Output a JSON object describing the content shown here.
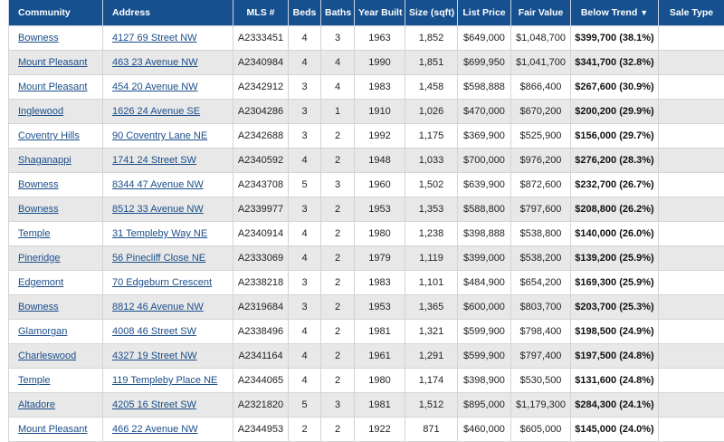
{
  "columns": {
    "community": "Community",
    "address": "Address",
    "mls": "MLS #",
    "beds": "Beds",
    "baths": "Baths",
    "year_built": "Year Built",
    "size": "Size (sqft)",
    "list_price": "List Price",
    "fair_value": "Fair Value",
    "below_trend": "Below Trend",
    "sale_type": "Sale Type"
  },
  "sort_indicator": "▼",
  "rows": [
    {
      "community": "Bowness",
      "address": "4127 69 Street NW",
      "mls": "A2333451",
      "beds": "4",
      "baths": "3",
      "year": "1963",
      "size": "1,852",
      "price": "$649,000",
      "fair": "$1,048,700",
      "trend": "$399,700 (38.1%)",
      "sale_type": ""
    },
    {
      "community": "Mount Pleasant",
      "address": "463 23 Avenue NW",
      "mls": "A2340984",
      "beds": "4",
      "baths": "4",
      "year": "1990",
      "size": "1,851",
      "price": "$699,950",
      "fair": "$1,041,700",
      "trend": "$341,700 (32.8%)",
      "sale_type": ""
    },
    {
      "community": "Mount Pleasant",
      "address": "454 20 Avenue NW",
      "mls": "A2342912",
      "beds": "3",
      "baths": "4",
      "year": "1983",
      "size": "1,458",
      "price": "$598,888",
      "fair": "$866,400",
      "trend": "$267,600 (30.9%)",
      "sale_type": ""
    },
    {
      "community": "Inglewood",
      "address": "1626 24 Avenue SE",
      "mls": "A2304286",
      "beds": "3",
      "baths": "1",
      "year": "1910",
      "size": "1,026",
      "price": "$470,000",
      "fair": "$670,200",
      "trend": "$200,200 (29.9%)",
      "sale_type": ""
    },
    {
      "community": "Coventry Hills",
      "address": "90 Coventry Lane NE",
      "mls": "A2342688",
      "beds": "3",
      "baths": "2",
      "year": "1992",
      "size": "1,175",
      "price": "$369,900",
      "fair": "$525,900",
      "trend": "$156,000 (29.7%)",
      "sale_type": ""
    },
    {
      "community": "Shaganappi",
      "address": "1741 24 Street SW",
      "mls": "A2340592",
      "beds": "4",
      "baths": "2",
      "year": "1948",
      "size": "1,033",
      "price": "$700,000",
      "fair": "$976,200",
      "trend": "$276,200 (28.3%)",
      "sale_type": ""
    },
    {
      "community": "Bowness",
      "address": "8344 47 Avenue NW",
      "mls": "A2343708",
      "beds": "5",
      "baths": "3",
      "year": "1960",
      "size": "1,502",
      "price": "$639,900",
      "fair": "$872,600",
      "trend": "$232,700 (26.7%)",
      "sale_type": ""
    },
    {
      "community": "Bowness",
      "address": "8512 33 Avenue NW",
      "mls": "A2339977",
      "beds": "3",
      "baths": "2",
      "year": "1953",
      "size": "1,353",
      "price": "$588,800",
      "fair": "$797,600",
      "trend": "$208,800 (26.2%)",
      "sale_type": ""
    },
    {
      "community": "Temple",
      "address": "31 Templeby Way NE",
      "mls": "A2340914",
      "beds": "4",
      "baths": "2",
      "year": "1980",
      "size": "1,238",
      "price": "$398,888",
      "fair": "$538,800",
      "trend": "$140,000 (26.0%)",
      "sale_type": ""
    },
    {
      "community": "Pineridge",
      "address": "56 Pinecliff Close NE",
      "mls": "A2333069",
      "beds": "4",
      "baths": "2",
      "year": "1979",
      "size": "1,119",
      "price": "$399,000",
      "fair": "$538,200",
      "trend": "$139,200 (25.9%)",
      "sale_type": ""
    },
    {
      "community": "Edgemont",
      "address": "70 Edgeburn Crescent",
      "mls": "A2338218",
      "beds": "3",
      "baths": "2",
      "year": "1983",
      "size": "1,101",
      "price": "$484,900",
      "fair": "$654,200",
      "trend": "$169,300 (25.9%)",
      "sale_type": ""
    },
    {
      "community": "Bowness",
      "address": "8812 46 Avenue NW",
      "mls": "A2319684",
      "beds": "3",
      "baths": "2",
      "year": "1953",
      "size": "1,365",
      "price": "$600,000",
      "fair": "$803,700",
      "trend": "$203,700 (25.3%)",
      "sale_type": ""
    },
    {
      "community": "Glamorgan",
      "address": "4008 46 Street SW",
      "mls": "A2338496",
      "beds": "4",
      "baths": "2",
      "year": "1981",
      "size": "1,321",
      "price": "$599,900",
      "fair": "$798,400",
      "trend": "$198,500 (24.9%)",
      "sale_type": ""
    },
    {
      "community": "Charleswood",
      "address": "4327 19 Street NW",
      "mls": "A2341164",
      "beds": "4",
      "baths": "2",
      "year": "1961",
      "size": "1,291",
      "price": "$599,900",
      "fair": "$797,400",
      "trend": "$197,500 (24.8%)",
      "sale_type": ""
    },
    {
      "community": "Temple",
      "address": "119 Templeby Place NE",
      "mls": "A2344065",
      "beds": "4",
      "baths": "2",
      "year": "1980",
      "size": "1,174",
      "price": "$398,900",
      "fair": "$530,500",
      "trend": "$131,600 (24.8%)",
      "sale_type": ""
    },
    {
      "community": "Altadore",
      "address": "4205 16 Street SW",
      "mls": "A2321820",
      "beds": "5",
      "baths": "3",
      "year": "1981",
      "size": "1,512",
      "price": "$895,000",
      "fair": "$1,179,300",
      "trend": "$284,300 (24.1%)",
      "sale_type": ""
    },
    {
      "community": "Mount Pleasant",
      "address": "466 22 Avenue NW",
      "mls": "A2344953",
      "beds": "2",
      "baths": "2",
      "year": "1922",
      "size": "871",
      "price": "$460,000",
      "fair": "$605,000",
      "trend": "$145,000 (24.0%)",
      "sale_type": ""
    }
  ]
}
